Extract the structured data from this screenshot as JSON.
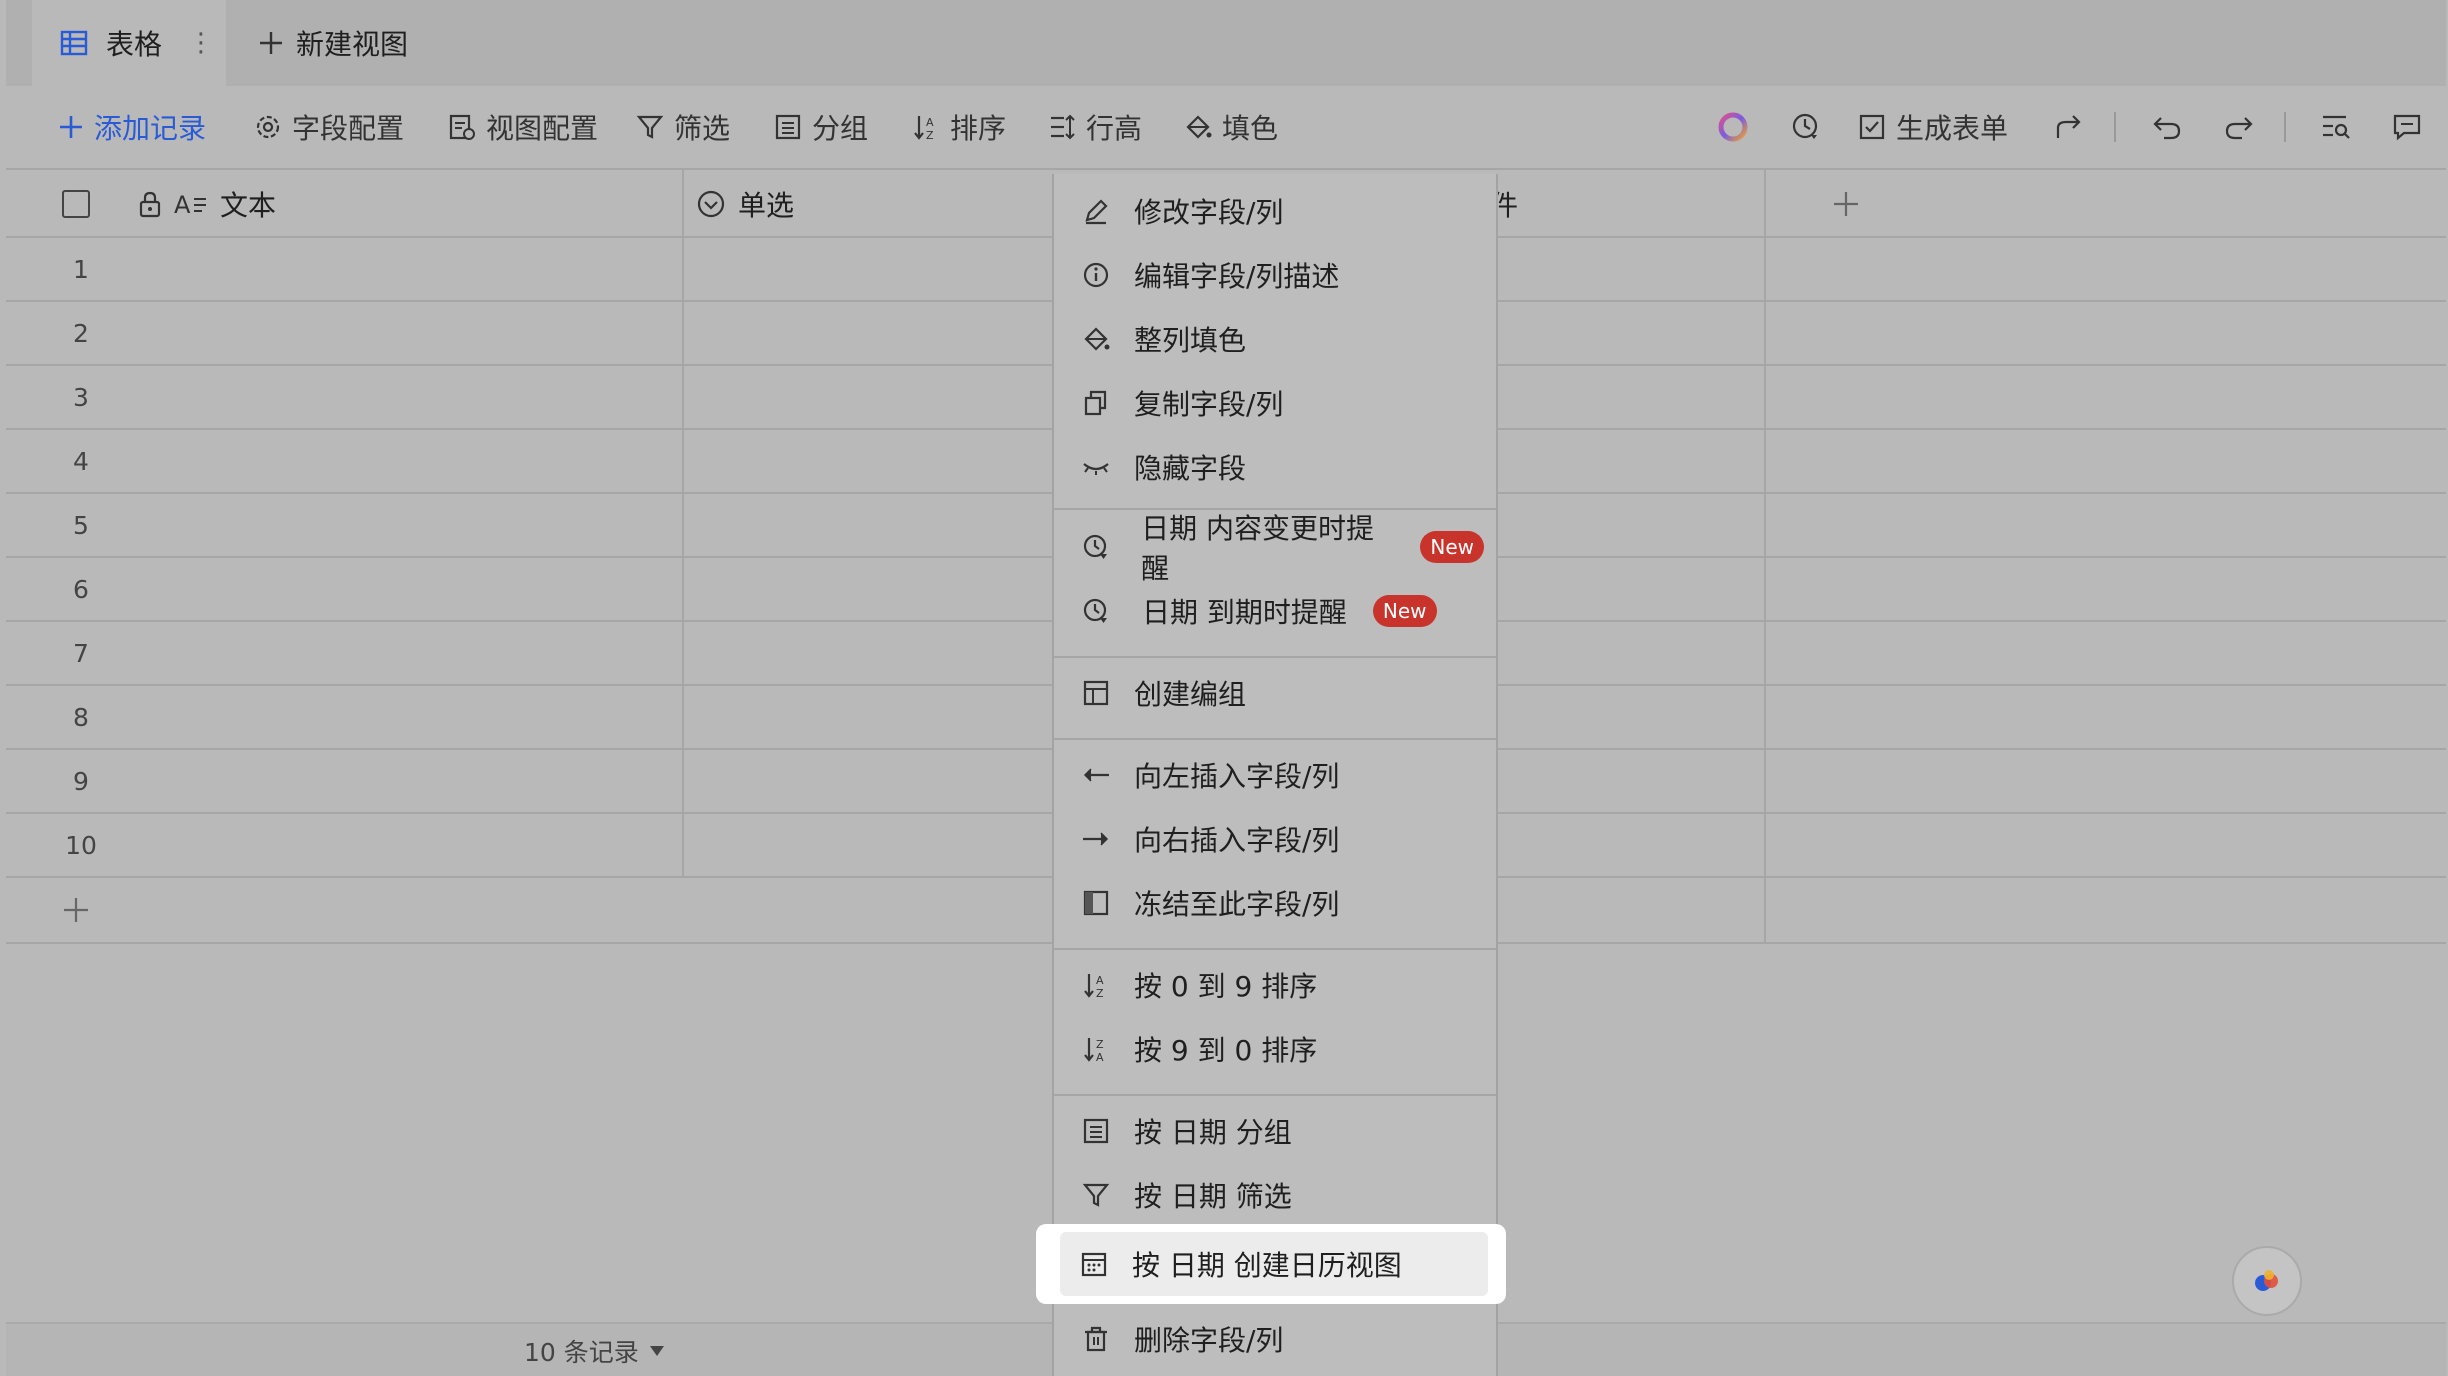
{
  "tabs": {
    "active_label": "表格",
    "active_dots": "⋮",
    "new_view_label": "新建视图"
  },
  "toolbar": {
    "add_record": "添加记录",
    "field_config": "字段配置",
    "view_config": "视图配置",
    "filter": "筛选",
    "group": "分组",
    "sort": "排序",
    "row_height": "行高",
    "fill_color": "填色",
    "generate_form": "生成表单"
  },
  "columns": {
    "text": "文本",
    "single_select": "单选",
    "partial": "件"
  },
  "rows": [
    "1",
    "2",
    "3",
    "4",
    "5",
    "6",
    "7",
    "8",
    "9",
    "10"
  ],
  "footer": {
    "record_count": "10 条记录"
  },
  "menu": {
    "items": [
      "修改字段/列",
      "编辑字段/列描述",
      "整列填色",
      "复制字段/列",
      "隐藏字段",
      "日期 内容变更时提醒",
      "日期 到期时提醒",
      "创建编组",
      "向左插入字段/列",
      "向右插入字段/列",
      "冻结至此字段/列",
      "按 0 到 9 排序",
      "按 9 到 0 排序",
      "按 日期 分组",
      "按 日期 筛选",
      "按 日期 创建日历视图",
      "删除字段/列"
    ],
    "badge": "New"
  },
  "colors": {
    "accent": "#2a5bd7",
    "badge": "#c8332b",
    "overlay": "#b9b9b9"
  }
}
